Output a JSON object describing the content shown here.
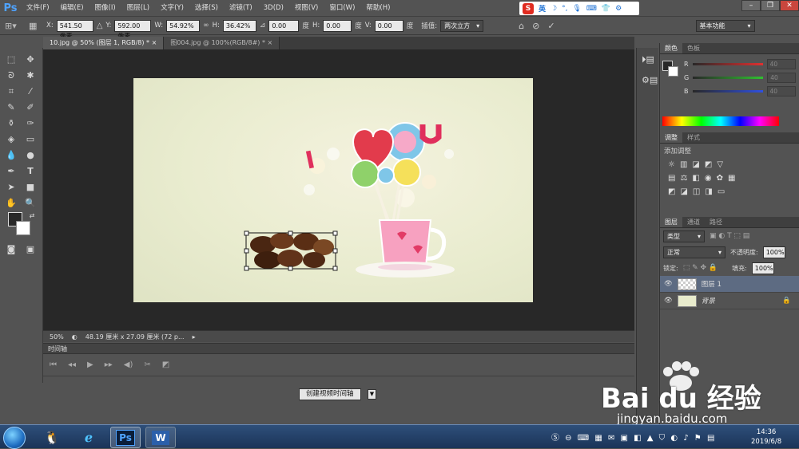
{
  "app": {
    "logo": "Ps"
  },
  "menu": [
    "文件(F)",
    "编辑(E)",
    "图像(I)",
    "图层(L)",
    "文字(Y)",
    "选择(S)",
    "滤镜(T)",
    "3D(D)",
    "视图(V)",
    "窗口(W)",
    "帮助(H)"
  ],
  "ime": {
    "logo": "S",
    "mode": "英"
  },
  "window_controls": {
    "minimize": "–",
    "restore": "❐",
    "close": "✕"
  },
  "options": {
    "x_label": "X:",
    "x_value": "541.50 像素",
    "y_label": "Y:",
    "y_value": "592.00 像素",
    "w_label": "W:",
    "w_value": "54.92%",
    "h_label": "H:",
    "h_value": "36.42%",
    "angle_value": "0.00",
    "angle_unit": "度",
    "hskew_label": "H:",
    "hskew_value": "0.00",
    "hskew_unit": "度",
    "vskew_label": "V:",
    "vskew_value": "0.00",
    "vskew_unit": "度",
    "interp_label": "插值:",
    "interp_value": "两次立方",
    "workspace": "基本功能"
  },
  "tabs": [
    {
      "label": "10.jpg @ 50% (图层 1, RGB/8) *",
      "close": "×"
    },
    {
      "label": "图004.jpg @ 100%(RGB/8#) *",
      "close": "×"
    }
  ],
  "status": {
    "zoom": "50%",
    "doc_info": "48.19 厘米 x 27.09 厘米 (72 p..."
  },
  "timeline": {
    "title": "时间轴",
    "create_button": "创建视频时间轴"
  },
  "color_panel": {
    "tabs": [
      "颜色",
      "色板"
    ],
    "channels": [
      {
        "label": "R",
        "value": "40",
        "color": "#e03030"
      },
      {
        "label": "G",
        "value": "40",
        "color": "#30c030"
      },
      {
        "label": "B",
        "value": "40",
        "color": "#3050e0"
      }
    ]
  },
  "adjust_panel": {
    "tabs": [
      "调整",
      "样式"
    ],
    "title": "添加调整"
  },
  "layers_panel": {
    "tabs": [
      "图层",
      "通道",
      "路径"
    ],
    "filter": "类型",
    "blend_mode": "正常",
    "opacity_label": "不透明度:",
    "opacity_value": "100%",
    "lock_label": "锁定:",
    "fill_label": "填充:",
    "fill_value": "100%",
    "layers": [
      {
        "name": "图层 1",
        "selected": true
      },
      {
        "name": "背景",
        "selected": false,
        "locked": true
      }
    ]
  },
  "taskbar": {
    "clock_time": "14:36",
    "clock_date": "2019/6/8",
    "ps_label": "Ps",
    "word_label": "W"
  },
  "watermark": {
    "brand": "Bai du 经验",
    "url": "jingyan.baidu.com"
  }
}
